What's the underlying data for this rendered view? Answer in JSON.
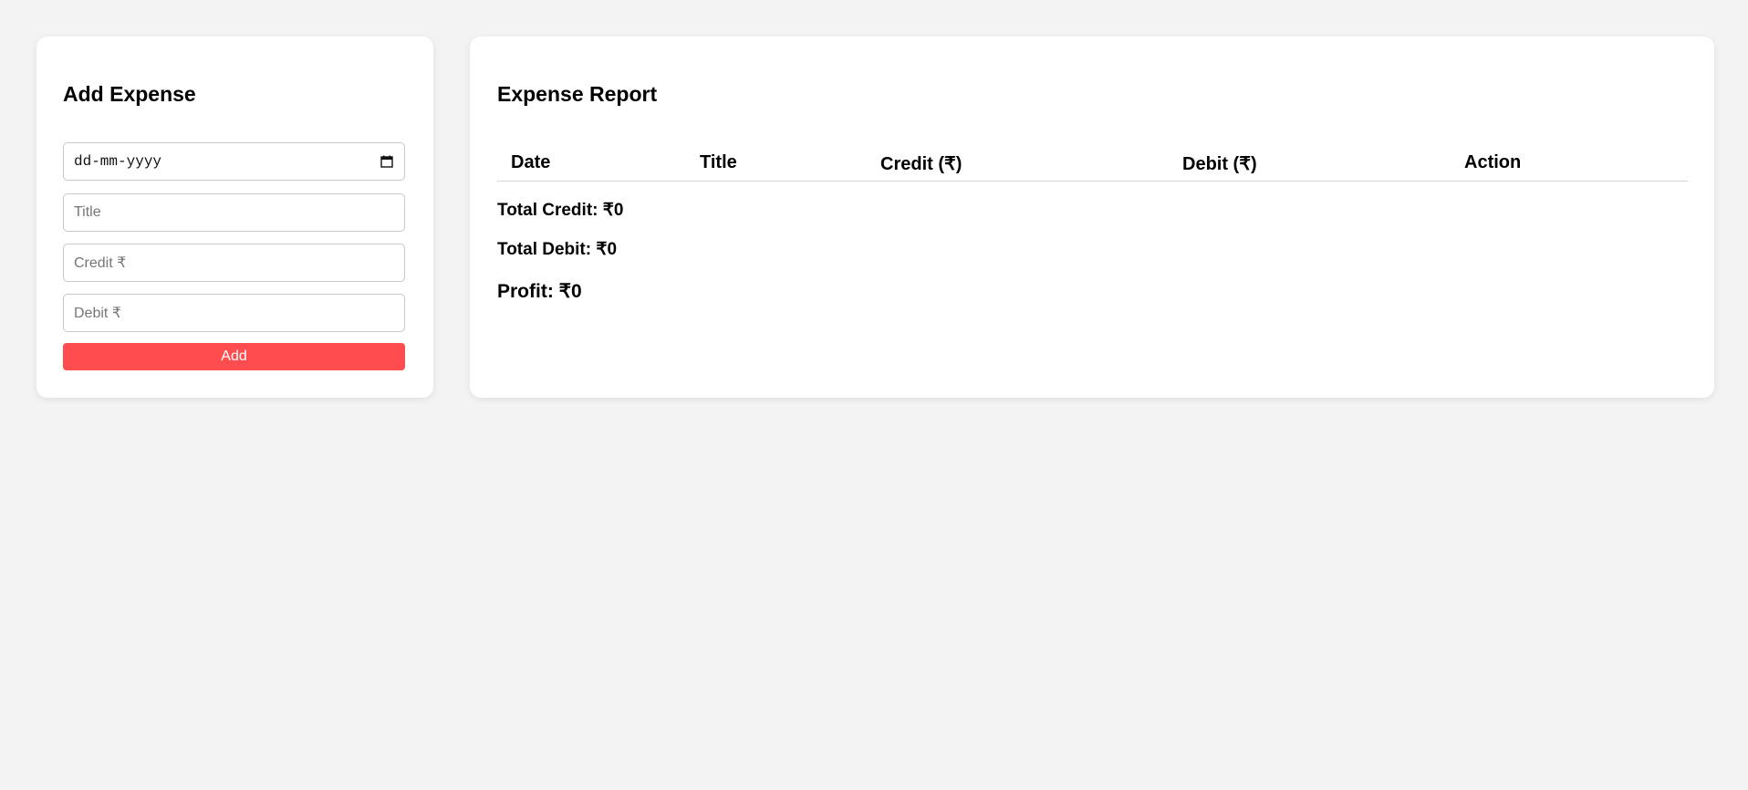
{
  "add_expense": {
    "heading": "Add Expense",
    "date_placeholder": "dd-mm-yyyy",
    "title_placeholder": "Title",
    "credit_placeholder": "Credit ₹",
    "debit_placeholder": "Debit ₹",
    "add_label": "Add",
    "button_color": "#ff4d4f"
  },
  "report": {
    "heading": "Expense Report",
    "columns": [
      "Date",
      "Title",
      "Credit (₹)",
      "Debit (₹)",
      "Action"
    ],
    "rows": [],
    "total_credit": "Total Credit: ₹0",
    "total_debit": "Total Debit: ₹0",
    "profit": "Profit: ₹0"
  },
  "icons": {
    "calendar": "calendar-icon"
  }
}
